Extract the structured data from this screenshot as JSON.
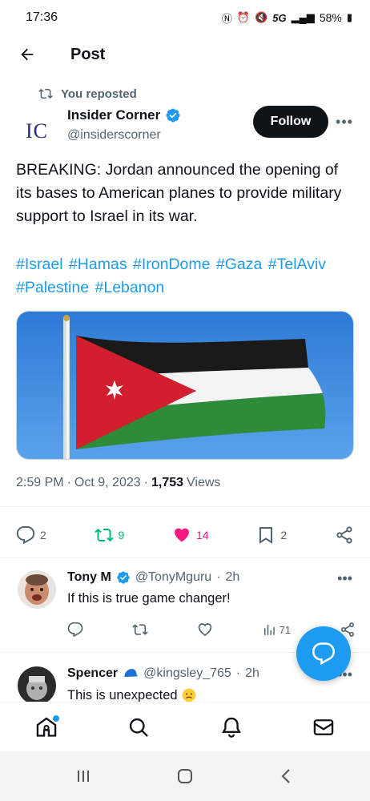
{
  "status_bar": {
    "time": "17:36",
    "network": "5G",
    "battery": "58%"
  },
  "header": {
    "title": "Post"
  },
  "post": {
    "repost_label": "You reposted",
    "author_avatar_text": "IC",
    "author_name": "Insider Corner",
    "author_handle": "@insiderscorner",
    "follow_label": "Follow",
    "text": "BREAKING: Jordan announced the opening of its bases to American planes to provide military support to Israel in its war.",
    "hashtags": [
      "#Israel",
      "#Hamas",
      "#IronDome",
      "#Gaza",
      "#TelAviv",
      "#Palestine",
      "#Lebanon"
    ],
    "time": "2:59 PM",
    "date": "Oct 9, 2023",
    "views_count": "1,753",
    "views_label": "Views",
    "reply_count": "2",
    "repost_count": "9",
    "like_count": "14",
    "bookmark_count": "2"
  },
  "replies": [
    {
      "name": "Tony M",
      "handle": "@TonyMguru",
      "time": "2h",
      "text": "If this is true game changer!",
      "views": "71"
    },
    {
      "name": "Spencer",
      "handle": "@kingsley_765",
      "time": "2h",
      "text": "This is unexpected"
    }
  ],
  "colors": {
    "accent": "#1d9bf0",
    "repost_green": "#00ba7c",
    "like_pink": "#f91880",
    "text": "#0f1419",
    "muted": "#536471"
  }
}
